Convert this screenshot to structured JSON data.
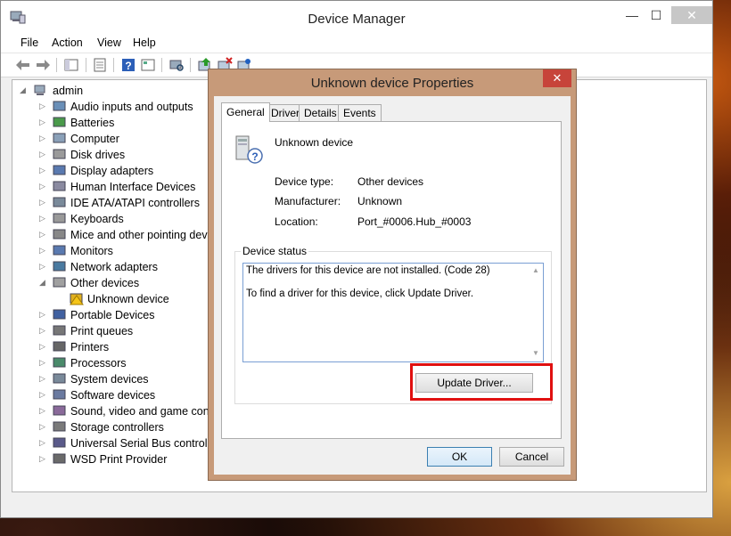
{
  "window": {
    "title": "Device Manager",
    "min_glyph": "—",
    "max_glyph": "☐",
    "close_glyph": "✕"
  },
  "menu": [
    "File",
    "Action",
    "View",
    "Help"
  ],
  "tree": {
    "root": "admin",
    "items": [
      {
        "label": "Audio inputs and outputs",
        "icon": "speaker-icon"
      },
      {
        "label": "Batteries",
        "icon": "battery-icon"
      },
      {
        "label": "Computer",
        "icon": "computer-icon"
      },
      {
        "label": "Disk drives",
        "icon": "disk-drive-icon"
      },
      {
        "label": "Display adapters",
        "icon": "display-adapter-icon"
      },
      {
        "label": "Human Interface Devices",
        "icon": "hid-icon"
      },
      {
        "label": "IDE ATA/ATAPI controllers",
        "icon": "ide-controller-icon"
      },
      {
        "label": "Keyboards",
        "icon": "keyboard-icon"
      },
      {
        "label": "Mice and other pointing devices",
        "icon": "mouse-icon"
      },
      {
        "label": "Monitors",
        "icon": "monitor-icon"
      },
      {
        "label": "Network adapters",
        "icon": "network-adapter-icon"
      },
      {
        "label": "Other devices",
        "icon": "other-devices-icon",
        "expanded": true
      },
      {
        "label": "Unknown device",
        "icon": "warning-device-icon",
        "child": true
      },
      {
        "label": "Portable Devices",
        "icon": "portable-device-icon"
      },
      {
        "label": "Print queues",
        "icon": "print-queue-icon"
      },
      {
        "label": "Printers",
        "icon": "printer-icon"
      },
      {
        "label": "Processors",
        "icon": "processor-icon"
      },
      {
        "label": "System devices",
        "icon": "system-device-icon"
      },
      {
        "label": "Software devices",
        "icon": "software-device-icon"
      },
      {
        "label": "Sound, video and game controllers",
        "icon": "sound-icon"
      },
      {
        "label": "Storage controllers",
        "icon": "storage-icon"
      },
      {
        "label": "Universal Serial Bus controllers",
        "icon": "usb-icon"
      },
      {
        "label": "WSD Print Provider",
        "icon": "wsd-printer-icon"
      }
    ]
  },
  "dialog": {
    "title": "Unknown device Properties",
    "close_glyph": "✕",
    "tabs": [
      "General",
      "Driver",
      "Details",
      "Events"
    ],
    "device_name": "Unknown device",
    "properties": [
      {
        "label": "Device type:",
        "value": "Other devices"
      },
      {
        "label": "Manufacturer:",
        "value": "Unknown"
      },
      {
        "label": "Location:",
        "value": "Port_#0006.Hub_#0003"
      }
    ],
    "status_legend": "Device status",
    "status_lines": [
      "The drivers for this device are not installed. (Code 28)",
      "To find a driver for this device, click Update Driver."
    ],
    "update_driver_label": "Update Driver...",
    "ok_label": "OK",
    "cancel_label": "Cancel"
  },
  "colors": {
    "dialog_frame": "#c79a79",
    "close_red": "#c7443a",
    "highlight_red": "#e01010"
  }
}
